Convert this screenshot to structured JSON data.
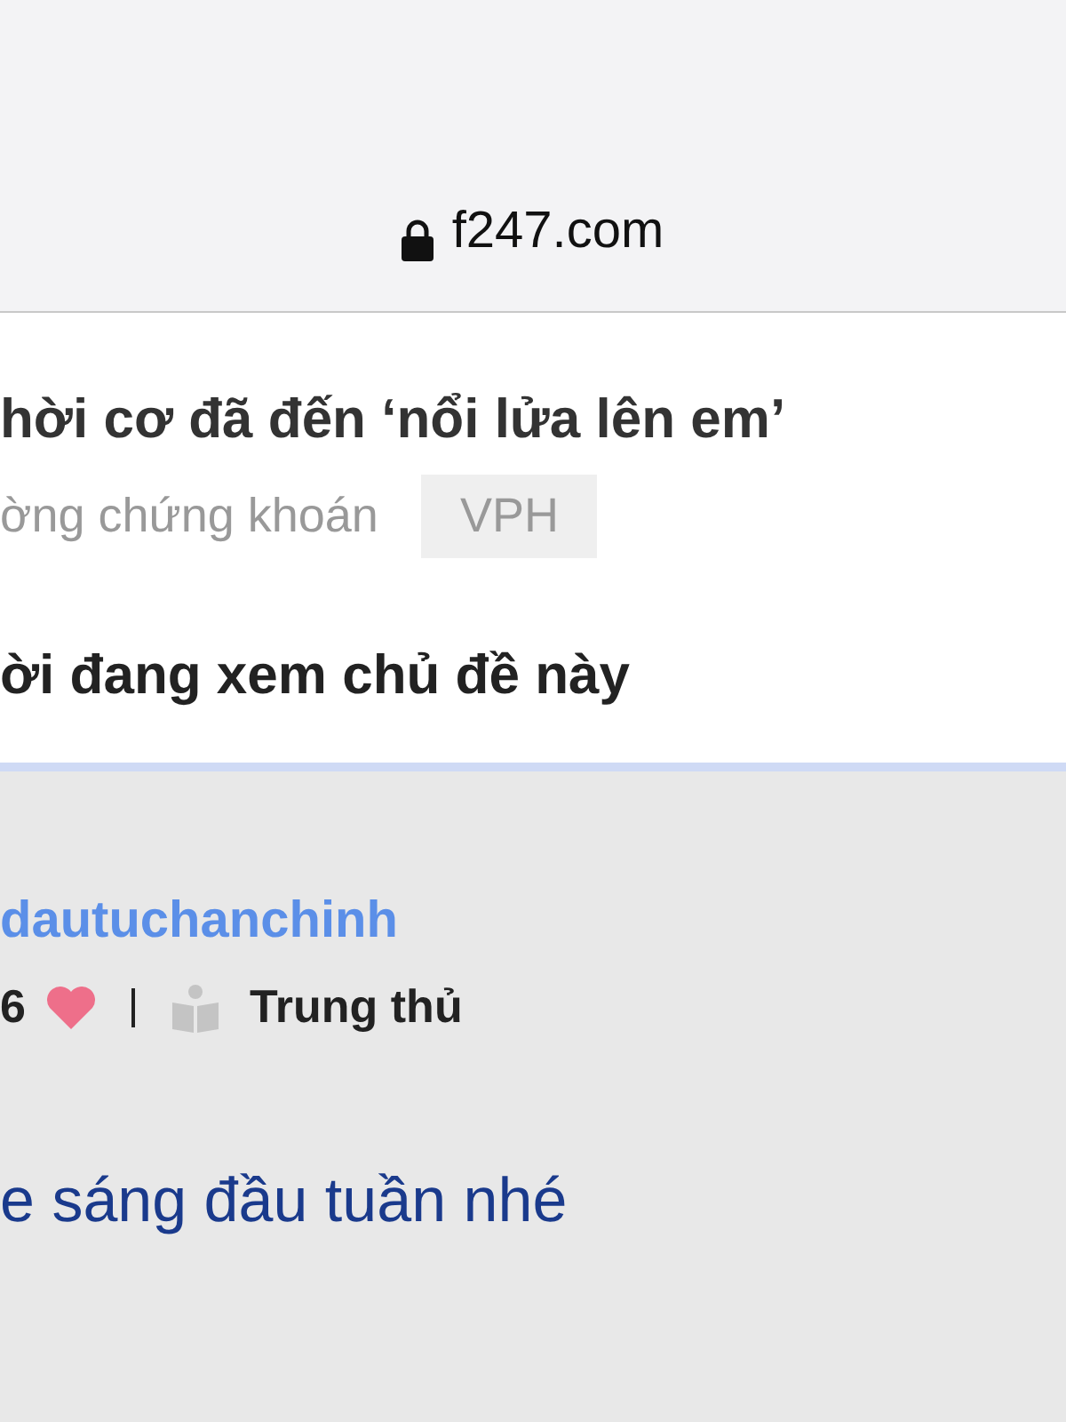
{
  "address_bar": {
    "url": "f247.com"
  },
  "thread": {
    "title": "hời cơ đã đến ‘nổi lửa lên em’",
    "category": "ờng chứng khoán",
    "tag": "VPH"
  },
  "viewers": {
    "heading": "ời đang xem chủ đề này"
  },
  "post": {
    "username": "dautuchanchinh",
    "likes": "6",
    "rank": "Trung thủ",
    "text": "e sáng đầu tuần nhé"
  }
}
